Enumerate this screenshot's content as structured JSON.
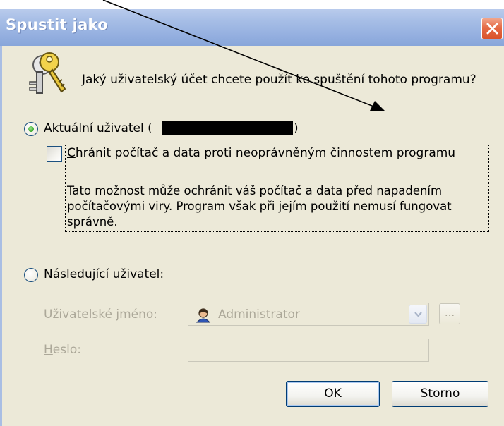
{
  "window": {
    "title": "Spustit jako"
  },
  "question": "Jaký uživatelský účet chcete použít ke spuštění tohoto programu?",
  "current_user": {
    "prefix_underlined": "A",
    "label_rest": "ktuální uživatel (",
    "closing": ")",
    "selected": true,
    "protect": {
      "prefix_underlined": "C",
      "label_rest": "hránit počítač a data proti neoprávněným činnostem programu",
      "checked": false,
      "description_lines": [
        "Tato možnost může ochránit váš počítač a data před napadením",
        "počítačovými viry. Program však při jejím použití nemusí fungovat",
        "správně."
      ]
    }
  },
  "other_user": {
    "prefix_underlined": "N",
    "label_rest": "ásledující uživatel:",
    "selected": false,
    "username_label_underlined": "U",
    "username_label_rest": "živatelské jméno:",
    "username_value": "Administrator",
    "browse_label": "...",
    "password_label_underlined": "H",
    "password_label_rest": "eslo:",
    "password_value": ""
  },
  "buttons": {
    "ok": "OK",
    "cancel": "Storno"
  },
  "icons": {
    "close": "close-icon",
    "keys": "keys-icon",
    "user": "user-icon",
    "dropdown": "chevron-down-icon"
  },
  "colors": {
    "titlebar": "#A7BEE6",
    "window_bg": "#ECE9D8",
    "close_button": "#E56A45",
    "disabled_text": "#ACA899",
    "radio_dot": "#3BAA2C"
  }
}
